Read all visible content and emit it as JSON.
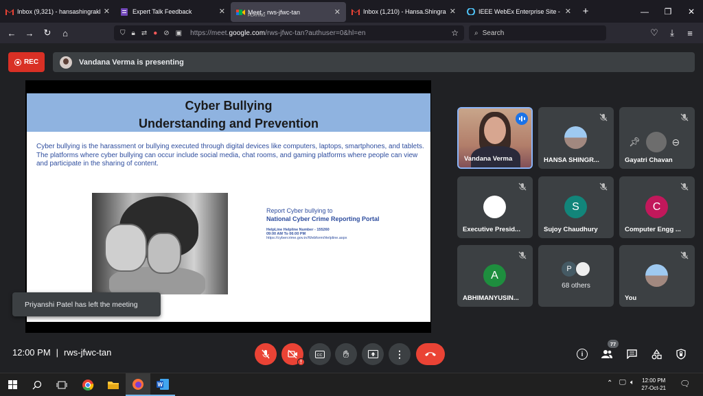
{
  "browser": {
    "tabs": [
      {
        "title": "Inbox (9,321) - hansashingrakhi",
        "icon": "gmail-icon",
        "color": "#d93025"
      },
      {
        "title": "Expert Talk Feedback",
        "icon": "forms-icon",
        "color": "#7248b9"
      },
      {
        "title": "Meet - rws-jfwc-tan",
        "subtitle": "PLAYING",
        "icon": "meet-icon",
        "color": "#00897b",
        "active": true
      },
      {
        "title": "Inbox (1,210) - Hansa.Shingrakhi",
        "icon": "gmail-icon",
        "color": "#d93025"
      },
      {
        "title": "IEEE WebEx Enterprise Site - Hom",
        "icon": "webex-icon",
        "color": "#1a73e8"
      }
    ],
    "url_prefix": "https://meet.",
    "url_domain": "google.com",
    "url_suffix": "/rws-jfwc-tan?authuser=0&hl=en",
    "search_placeholder": "Search"
  },
  "meeting": {
    "rec_label": "REC",
    "presenting_text": "Vandana Verma is presenting",
    "code": "rws-jfwc-tan",
    "time": "12:00 PM",
    "separator": "|",
    "participant_count": "77",
    "toast": "Priyanshi Patel has left the meeting"
  },
  "slide": {
    "title": "Cyber Bullying",
    "subtitle": "Understanding and Prevention",
    "body": "Cyber bullying is the harassment or bullying executed through digital devices like computers, laptops, smartphones, and tablets. The platforms where cyber bullying can occur include social media, chat rooms, and gaming platforms where people can view and participate in the sharing of content.",
    "report_line1": "Report Cyber bullying to",
    "report_line2": "National Cyber Crime Reporting Portal",
    "helpline": "HelpLine Helpline Number - 155260",
    "hours": "09:00 AM To 06:00 PM",
    "link": "https://cybercrime.gov.in/Webform/Helpline.aspx"
  },
  "participants": [
    {
      "name": "Vandana Verma",
      "type": "video"
    },
    {
      "name": "HANSA SHINGR...",
      "type": "image"
    },
    {
      "name": "Gayatri Chavan",
      "type": "hover"
    },
    {
      "name": "Executive Presid...",
      "type": "letter",
      "letter": "",
      "color": "#ffffff"
    },
    {
      "name": "Sujoy Chaudhury",
      "type": "letter",
      "letter": "S",
      "color": "#12857a"
    },
    {
      "name": "Computer Engg ...",
      "type": "letter",
      "letter": "C",
      "color": "#c2185b"
    },
    {
      "name": "ABHIMANYUSIN...",
      "type": "letter",
      "letter": "A",
      "color": "#1e8e3e"
    },
    {
      "name": "68 others",
      "type": "others",
      "letter": "P"
    },
    {
      "name": "You",
      "type": "image"
    }
  ],
  "taskbar": {
    "time": "12:00 PM",
    "date": "27-Oct-21"
  }
}
